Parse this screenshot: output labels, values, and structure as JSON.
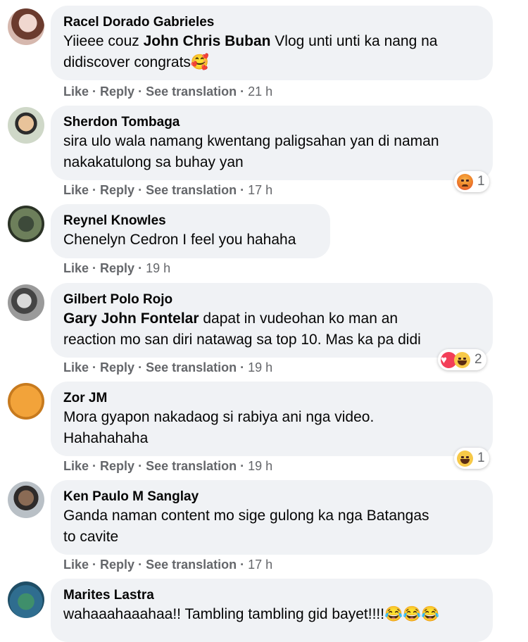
{
  "comments": [
    {
      "name": "Racel Dorado Gabrieles",
      "mention": "John Chris Buban",
      "text_before": "Yiieee couz ",
      "text_after": " Vlog unti unti ka nang na\ndidiscover congrats🥰",
      "like": "Like",
      "reply": "Reply",
      "translate": "See translation",
      "time": "21 h"
    },
    {
      "name": "Sherdon Tombaga",
      "text": "sira ulo wala namang kwentang paligsahan yan di naman\nnakakatulong sa buhay yan",
      "like": "Like",
      "reply": "Reply",
      "translate": "See translation",
      "time": "17 h",
      "reaction_count": "1"
    },
    {
      "name": "Reynel Knowles",
      "text": "Chenelyn Cedron I feel you hahaha",
      "like": "Like",
      "reply": "Reply",
      "time": "19 h"
    },
    {
      "name": "Gilbert Polo Rojo",
      "mention": "Gary John Fontelar",
      "text_after": " dapat in vudeohan ko man an\nreaction mo san diri natawag sa top 10. Mas ka pa didi",
      "like": "Like",
      "reply": "Reply",
      "translate": "See translation",
      "time": "19 h",
      "reaction_count": "2"
    },
    {
      "name": "Zor JM",
      "text": "Mora gyapon nakadaog si rabiya ani nga video.\nHahahahaha",
      "like": "Like",
      "reply": "Reply",
      "translate": "See translation",
      "time": "19 h",
      "reaction_count": "1"
    },
    {
      "name": "Ken Paulo M Sanglay",
      "text": "Ganda naman content mo sige gulong ka nga Batangas\nto cavite",
      "like": "Like",
      "reply": "Reply",
      "translate": "See translation",
      "time": "17 h"
    },
    {
      "name": "Marites Lastra",
      "text": "wahaaahaaahaa!! Tambling tambling gid bayet!!!!😂😂😂"
    }
  ],
  "separator": " · ",
  "colors": {
    "bubble": "#f0f2f5",
    "meta": "#65676b",
    "text": "#050505"
  }
}
